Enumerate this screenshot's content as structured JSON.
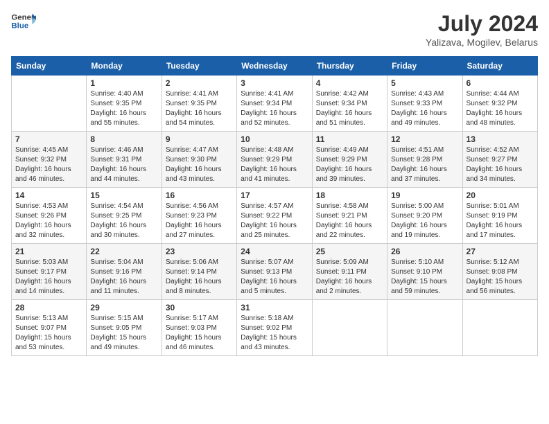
{
  "header": {
    "logo_line1": "General",
    "logo_line2": "Blue",
    "month_year": "July 2024",
    "location": "Yalizava, Mogilev, Belarus"
  },
  "days_of_week": [
    "Sunday",
    "Monday",
    "Tuesday",
    "Wednesday",
    "Thursday",
    "Friday",
    "Saturday"
  ],
  "weeks": [
    [
      {
        "day": "",
        "info": ""
      },
      {
        "day": "1",
        "info": "Sunrise: 4:40 AM\nSunset: 9:35 PM\nDaylight: 16 hours\nand 55 minutes."
      },
      {
        "day": "2",
        "info": "Sunrise: 4:41 AM\nSunset: 9:35 PM\nDaylight: 16 hours\nand 54 minutes."
      },
      {
        "day": "3",
        "info": "Sunrise: 4:41 AM\nSunset: 9:34 PM\nDaylight: 16 hours\nand 52 minutes."
      },
      {
        "day": "4",
        "info": "Sunrise: 4:42 AM\nSunset: 9:34 PM\nDaylight: 16 hours\nand 51 minutes."
      },
      {
        "day": "5",
        "info": "Sunrise: 4:43 AM\nSunset: 9:33 PM\nDaylight: 16 hours\nand 49 minutes."
      },
      {
        "day": "6",
        "info": "Sunrise: 4:44 AM\nSunset: 9:32 PM\nDaylight: 16 hours\nand 48 minutes."
      }
    ],
    [
      {
        "day": "7",
        "info": "Sunrise: 4:45 AM\nSunset: 9:32 PM\nDaylight: 16 hours\nand 46 minutes."
      },
      {
        "day": "8",
        "info": "Sunrise: 4:46 AM\nSunset: 9:31 PM\nDaylight: 16 hours\nand 44 minutes."
      },
      {
        "day": "9",
        "info": "Sunrise: 4:47 AM\nSunset: 9:30 PM\nDaylight: 16 hours\nand 43 minutes."
      },
      {
        "day": "10",
        "info": "Sunrise: 4:48 AM\nSunset: 9:29 PM\nDaylight: 16 hours\nand 41 minutes."
      },
      {
        "day": "11",
        "info": "Sunrise: 4:49 AM\nSunset: 9:29 PM\nDaylight: 16 hours\nand 39 minutes."
      },
      {
        "day": "12",
        "info": "Sunrise: 4:51 AM\nSunset: 9:28 PM\nDaylight: 16 hours\nand 37 minutes."
      },
      {
        "day": "13",
        "info": "Sunrise: 4:52 AM\nSunset: 9:27 PM\nDaylight: 16 hours\nand 34 minutes."
      }
    ],
    [
      {
        "day": "14",
        "info": "Sunrise: 4:53 AM\nSunset: 9:26 PM\nDaylight: 16 hours\nand 32 minutes."
      },
      {
        "day": "15",
        "info": "Sunrise: 4:54 AM\nSunset: 9:25 PM\nDaylight: 16 hours\nand 30 minutes."
      },
      {
        "day": "16",
        "info": "Sunrise: 4:56 AM\nSunset: 9:23 PM\nDaylight: 16 hours\nand 27 minutes."
      },
      {
        "day": "17",
        "info": "Sunrise: 4:57 AM\nSunset: 9:22 PM\nDaylight: 16 hours\nand 25 minutes."
      },
      {
        "day": "18",
        "info": "Sunrise: 4:58 AM\nSunset: 9:21 PM\nDaylight: 16 hours\nand 22 minutes."
      },
      {
        "day": "19",
        "info": "Sunrise: 5:00 AM\nSunset: 9:20 PM\nDaylight: 16 hours\nand 19 minutes."
      },
      {
        "day": "20",
        "info": "Sunrise: 5:01 AM\nSunset: 9:19 PM\nDaylight: 16 hours\nand 17 minutes."
      }
    ],
    [
      {
        "day": "21",
        "info": "Sunrise: 5:03 AM\nSunset: 9:17 PM\nDaylight: 16 hours\nand 14 minutes."
      },
      {
        "day": "22",
        "info": "Sunrise: 5:04 AM\nSunset: 9:16 PM\nDaylight: 16 hours\nand 11 minutes."
      },
      {
        "day": "23",
        "info": "Sunrise: 5:06 AM\nSunset: 9:14 PM\nDaylight: 16 hours\nand 8 minutes."
      },
      {
        "day": "24",
        "info": "Sunrise: 5:07 AM\nSunset: 9:13 PM\nDaylight: 16 hours\nand 5 minutes."
      },
      {
        "day": "25",
        "info": "Sunrise: 5:09 AM\nSunset: 9:11 PM\nDaylight: 16 hours\nand 2 minutes."
      },
      {
        "day": "26",
        "info": "Sunrise: 5:10 AM\nSunset: 9:10 PM\nDaylight: 15 hours\nand 59 minutes."
      },
      {
        "day": "27",
        "info": "Sunrise: 5:12 AM\nSunset: 9:08 PM\nDaylight: 15 hours\nand 56 minutes."
      }
    ],
    [
      {
        "day": "28",
        "info": "Sunrise: 5:13 AM\nSunset: 9:07 PM\nDaylight: 15 hours\nand 53 minutes."
      },
      {
        "day": "29",
        "info": "Sunrise: 5:15 AM\nSunset: 9:05 PM\nDaylight: 15 hours\nand 49 minutes."
      },
      {
        "day": "30",
        "info": "Sunrise: 5:17 AM\nSunset: 9:03 PM\nDaylight: 15 hours\nand 46 minutes."
      },
      {
        "day": "31",
        "info": "Sunrise: 5:18 AM\nSunset: 9:02 PM\nDaylight: 15 hours\nand 43 minutes."
      },
      {
        "day": "",
        "info": ""
      },
      {
        "day": "",
        "info": ""
      },
      {
        "day": "",
        "info": ""
      }
    ]
  ]
}
